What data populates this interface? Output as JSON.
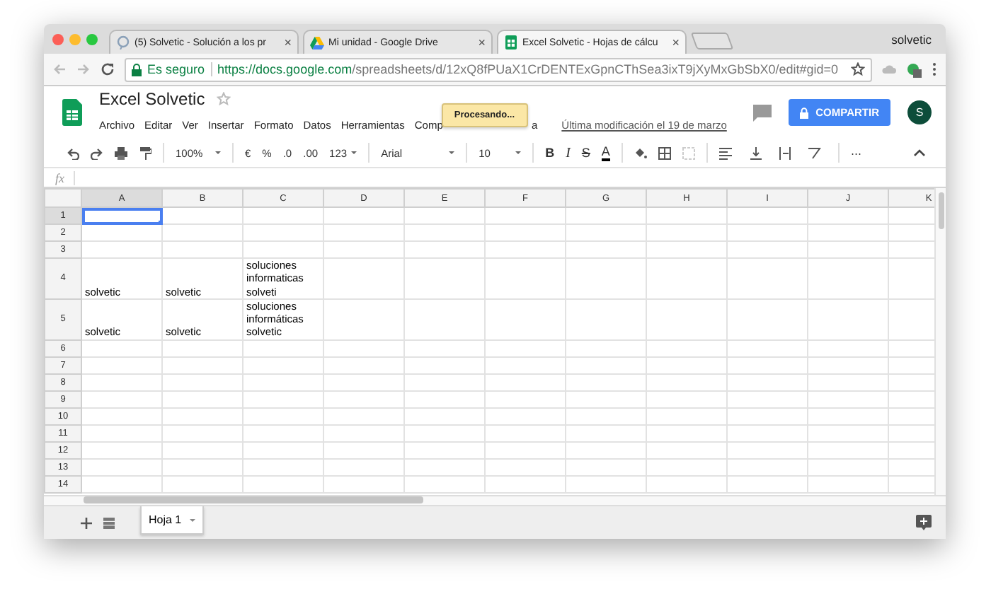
{
  "browser": {
    "tabs": [
      {
        "title": "(5) Solvetic - Solución a los pr",
        "close": "×",
        "selected": false
      },
      {
        "title": "Mi unidad - Google Drive",
        "close": "×",
        "selected": false
      },
      {
        "title": "Excel Solvetic - Hojas de cálcu",
        "close": "×",
        "selected": true
      }
    ],
    "profile": "solvetic",
    "security": "Es seguro",
    "url_host": "https://docs.google.com",
    "url_path": "/spreadsheets/d/12xQ8fPUaX1CrDENTExGpnCThSea3ixT9jXyMxGbSbX0/edit#gid=0"
  },
  "doc": {
    "title": "Excel Solvetic",
    "menu": [
      "Archivo",
      "Editar",
      "Ver",
      "Insertar",
      "Formato",
      "Datos",
      "Herramientas",
      "Comp",
      "a"
    ],
    "status_tooltip": "Procesando...",
    "last_modified": "Última modificación el 19 de marzo",
    "share": "COMPARTIR",
    "avatar": "S"
  },
  "toolbar": {
    "zoom": "100%",
    "currency": "€",
    "percent": "%",
    "decimal_less": ".0",
    "decimal_more": ".00",
    "number_format": "123",
    "font": "Arial",
    "font_size": "10",
    "bold": "B",
    "italic": "I",
    "strikethrough": "S",
    "text_color": "A",
    "more": "⋯"
  },
  "formula_bar": {
    "label": "fx"
  },
  "sheet": {
    "columns": [
      {
        "label": "A",
        "selected": true
      },
      {
        "label": "B",
        "selected": false
      },
      {
        "label": "C",
        "selected": false
      },
      {
        "label": "D",
        "selected": false
      },
      {
        "label": "E",
        "selected": false
      },
      {
        "label": "F",
        "selected": false
      },
      {
        "label": "G",
        "selected": false
      },
      {
        "label": "H",
        "selected": false
      },
      {
        "label": "I",
        "selected": false
      },
      {
        "label": "J",
        "selected": false
      },
      {
        "label": "K",
        "selected": false
      }
    ],
    "rows": [
      {
        "label": "1",
        "selected": true
      },
      {
        "label": "2",
        "selected": false
      },
      {
        "label": "3",
        "selected": false
      },
      {
        "label": "4",
        "selected": false,
        "cells": [
          "solvetic",
          "solvetic",
          "soluciones\ninformaticas\nsolveti"
        ]
      },
      {
        "label": "5",
        "selected": false,
        "cells": [
          "solvetic",
          "solvetic",
          "soluciones\ninformáticas\nsolvetic"
        ]
      },
      {
        "label": "6",
        "selected": false
      },
      {
        "label": "7",
        "selected": false
      },
      {
        "label": "8",
        "selected": false
      },
      {
        "label": "9",
        "selected": false
      },
      {
        "label": "10",
        "selected": false
      },
      {
        "label": "11",
        "selected": false
      },
      {
        "label": "12",
        "selected": false
      },
      {
        "label": "13",
        "selected": false
      },
      {
        "label": "14",
        "selected": false
      }
    ]
  },
  "sheet_tabs": [
    {
      "label": "Hoja 1",
      "selected": true
    }
  ]
}
